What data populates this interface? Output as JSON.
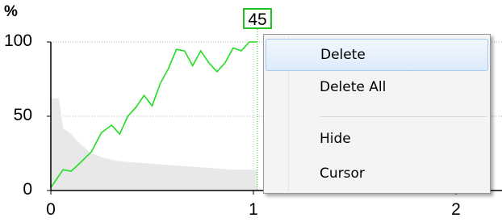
{
  "chart_data": {
    "type": "line",
    "ylabel": "%",
    "xlim": [
      0,
      2.2
    ],
    "ylim": [
      0,
      100
    ],
    "xticks": [
      "0",
      "1",
      "2"
    ],
    "yticks": [
      "0",
      "50",
      "100"
    ],
    "grid": true,
    "series": [
      {
        "color": "#22dd22",
        "x": [
          0,
          0.06,
          0.1,
          0.14,
          0.2,
          0.25,
          0.3,
          0.34,
          0.38,
          0.42,
          0.46,
          0.5,
          0.54,
          0.58,
          0.62,
          0.66,
          0.7,
          0.74,
          0.78,
          0.82,
          0.86,
          0.9,
          0.94,
          0.98,
          1.02
        ],
        "y": [
          2,
          14,
          13,
          18,
          26,
          39,
          44,
          38,
          50,
          56,
          64,
          57,
          72,
          82,
          95,
          94,
          84,
          94,
          86,
          80,
          86,
          96,
          94,
          100,
          100
        ]
      },
      {
        "color": "#e8e8e8",
        "fill": true,
        "x": [
          0,
          0.04,
          0.06,
          0.1,
          0.14,
          0.2,
          0.26,
          0.32,
          0.4,
          0.5,
          0.6,
          0.7,
          0.8,
          0.9,
          1.0,
          1.02
        ],
        "y": [
          62,
          62,
          42,
          38,
          32,
          25,
          22,
          20,
          19,
          18,
          17,
          16,
          15,
          14,
          14,
          14
        ]
      }
    ]
  },
  "cursor": {
    "label": "45",
    "color": "#22c222",
    "x": 1.02
  },
  "context_menu": {
    "items": [
      {
        "label": "Delete",
        "hovered": true
      },
      {
        "label": "Delete All",
        "hovered": false
      },
      {
        "label": "Hide",
        "hovered": false
      },
      {
        "label": "Cursor",
        "hovered": false
      }
    ]
  }
}
